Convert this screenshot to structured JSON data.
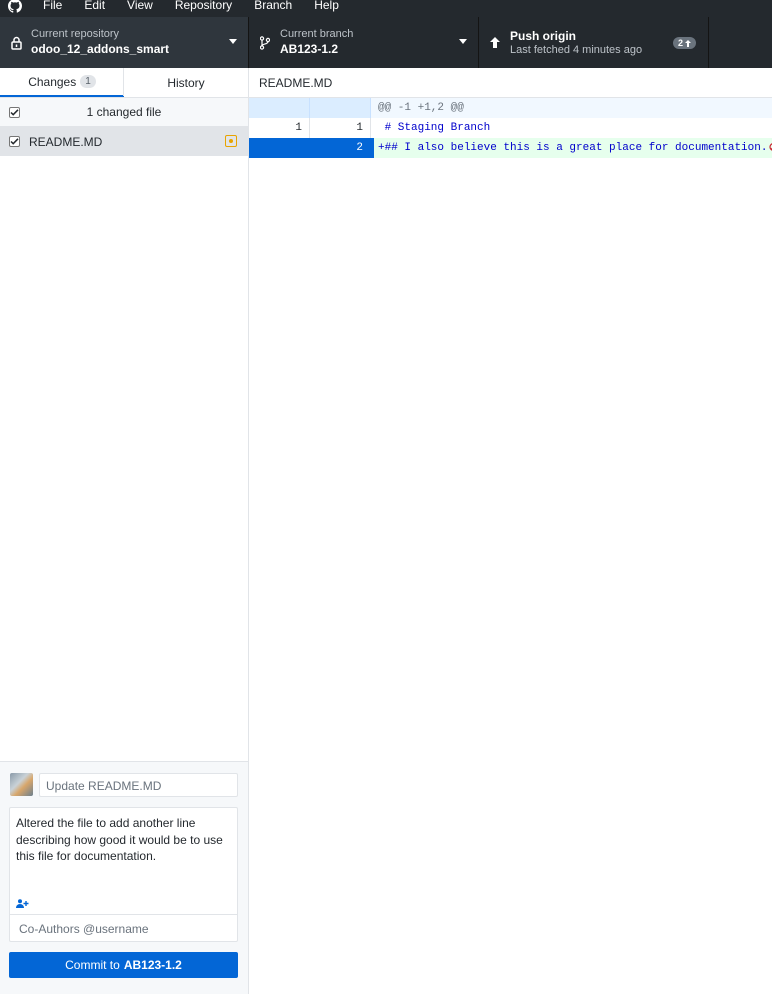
{
  "menu": {
    "items": [
      "File",
      "Edit",
      "View",
      "Repository",
      "Branch",
      "Help"
    ]
  },
  "toolbar": {
    "repo": {
      "desc": "Current repository",
      "title": "odoo_12_addons_smart"
    },
    "branch": {
      "desc": "Current branch",
      "title": "AB123-1.2"
    },
    "push": {
      "title": "Push origin",
      "desc": "Last fetched 4 minutes ago",
      "badge": "2"
    }
  },
  "sidebar": {
    "tabs": [
      {
        "label": "Changes",
        "count": "1"
      },
      {
        "label": "History"
      }
    ],
    "changed_header": "1 changed file",
    "files": [
      {
        "name": "README.MD",
        "status": "modified"
      }
    ]
  },
  "commit": {
    "summary_placeholder": "Update README.MD",
    "description": "Altered the file to add another line describing how good it would be to use this file for documentation.",
    "coauthors_placeholder": "Co-Authors @username",
    "button_prefix": "Commit to",
    "button_branch": "AB123-1.2"
  },
  "diff": {
    "file": "README.MD",
    "hunk": "@@ -1 +1,2 @@",
    "lines": [
      {
        "old": "1",
        "new": "1",
        "text": " # Staging Branch"
      },
      {
        "old": "",
        "new": "2",
        "text": "+## I also believe this is a great place for documentation."
      }
    ]
  },
  "colors": {
    "accent": "#0366d6",
    "toolbar_bg": "#24292e",
    "modified": "#e8a400",
    "added_bg": "#e6ffed"
  }
}
